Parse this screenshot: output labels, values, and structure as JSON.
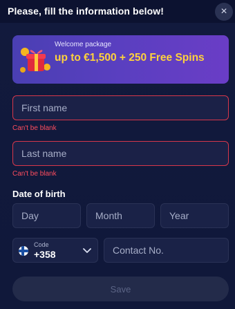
{
  "header": {
    "title": "Please, fill the information below!",
    "close_label": "×"
  },
  "banner": {
    "small": "Welcome package",
    "headline": "up to €1,500 + 250 Free Spins"
  },
  "fields": {
    "first_name": {
      "placeholder": "First name",
      "error": "Can't be blank"
    },
    "last_name": {
      "placeholder": "Last name",
      "error": "Can't be blank"
    }
  },
  "dob": {
    "label": "Date of birth",
    "day": "Day",
    "month": "Month",
    "year": "Year"
  },
  "phone": {
    "code_label": "Code",
    "code_value": "+358",
    "placeholder": "Contact No."
  },
  "actions": {
    "save": "Save"
  },
  "colors": {
    "accent_yellow": "#ffd23c",
    "error_red": "#ff4d5e",
    "banner_purple": "#5a3fc0"
  }
}
